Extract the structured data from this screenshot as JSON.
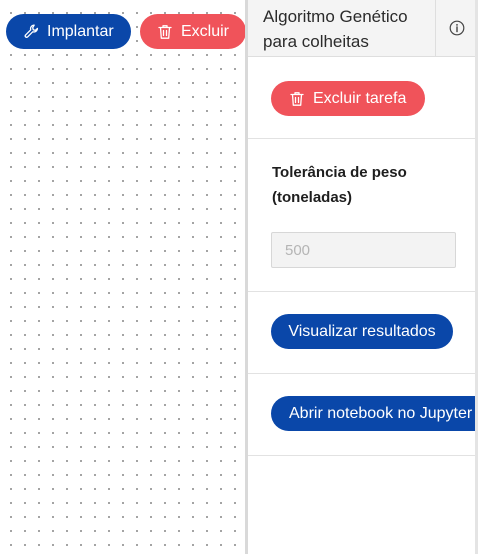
{
  "toolbar": {
    "deploy_label": "Implantar",
    "delete_label": "Excluir"
  },
  "panel": {
    "title": "Algoritmo Genético para colheitas",
    "delete_task_label": "Excluir tarefa",
    "weight_field": {
      "label": "Tolerância de peso (toneladas)",
      "placeholder": "500"
    },
    "view_results_label": "Visualizar resultados",
    "open_notebook_label": "Abrir notebook no Jupyter"
  },
  "icons": {
    "deploy": "wrench-icon",
    "delete": "trash-icon",
    "info": "info-icon"
  },
  "colors": {
    "primary": "#0a47a9",
    "danger": "#f0535a"
  }
}
